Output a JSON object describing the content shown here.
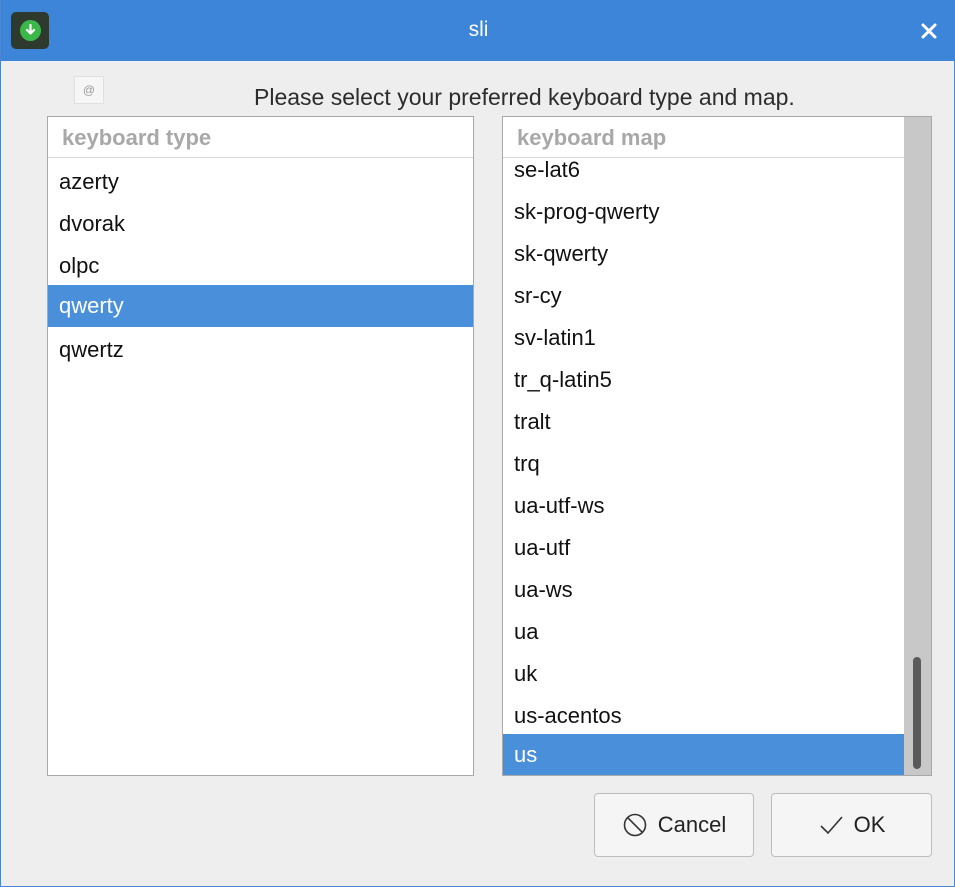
{
  "window": {
    "title": "sli"
  },
  "prompt": {
    "text": "Please select your preferred keyboard type and map."
  },
  "keyboard_type": {
    "header": "keyboard type",
    "items": [
      "azerty",
      "dvorak",
      "olpc",
      "qwerty",
      "qwertz"
    ],
    "selected": "qwerty"
  },
  "keyboard_map": {
    "header": "keyboard map",
    "items": [
      "se-lat6",
      "sk-prog-qwerty",
      "sk-qwerty",
      "sr-cy",
      "sv-latin1",
      "tr_q-latin5",
      "tralt",
      "trq",
      "ua-utf-ws",
      "ua-utf",
      "ua-ws",
      "ua",
      "uk",
      "us-acentos",
      "us"
    ],
    "selected": "us"
  },
  "buttons": {
    "cancel_label": "Cancel",
    "ok_label": "OK"
  },
  "colors": {
    "titlebar": "#3d85d9",
    "selection": "#4a8fd9",
    "app_icon_green": "#3cb84a"
  }
}
